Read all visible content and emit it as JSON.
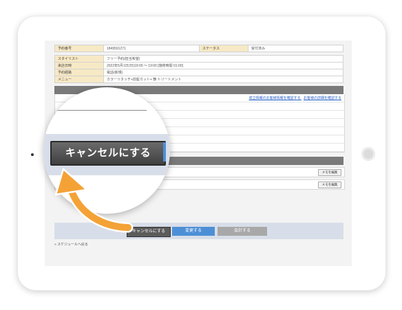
{
  "reservation": {
    "rows": [
      {
        "label": "予約番号",
        "value": "1849591271",
        "label2": "ステータス",
        "value2": "受付済み"
      },
      {
        "label": "スタイリスト",
        "value": "フリー予約(担当希望)"
      },
      {
        "label": "来店日時",
        "value": "2022年5月1日(日)19:00 〜 19:00 [施術時間 01:00]"
      },
      {
        "label": "予約経路",
        "value": "電話(新規)"
      },
      {
        "label": "メニュー",
        "value": "カラーリタッチ+前髪カット+ 艶 トリートメント"
      }
    ]
  },
  "links": {
    "salon_info": "成立情報のお客様情報を確認する",
    "detail": "お客様の詳細を確認する"
  },
  "memo": {
    "button_1": "メモを編集",
    "button_2": "メモを編集"
  },
  "actions": {
    "cancel": "キャンセルにする",
    "change": "変更する",
    "checkout": "会計する"
  },
  "back_link": "« スケジュールへ戻る",
  "magnified": {
    "cancel": "キャンセルにする"
  },
  "colors": {
    "label_bg": "#f7e9c5",
    "cancel_button": "#4a4a4a",
    "change_button": "#4d8fd6",
    "checkout_button": "#a8a8a8",
    "arrow": "#f4a236",
    "action_bar": "#d8dee9"
  },
  "icons": {
    "pointer": "curved-arrow-icon"
  }
}
